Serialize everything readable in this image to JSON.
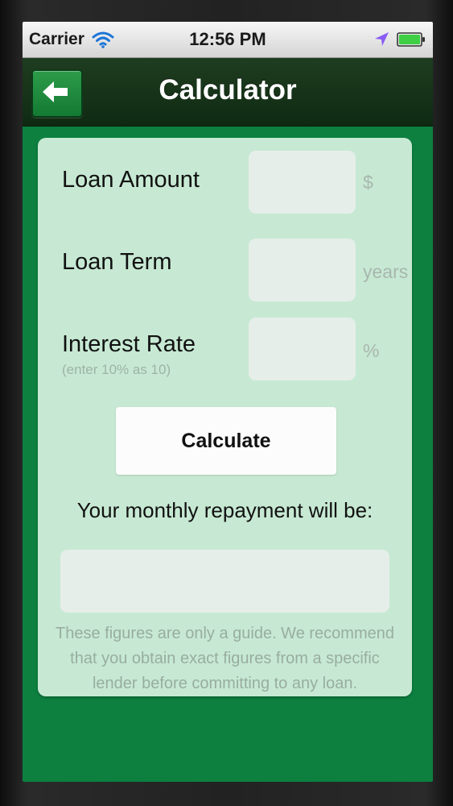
{
  "status_bar": {
    "carrier": "Carrier",
    "time": "12:56 PM"
  },
  "nav": {
    "title": "Calculator",
    "back_icon": "arrow-left-icon"
  },
  "form": {
    "loan_amount": {
      "label": "Loan Amount",
      "value": "",
      "unit": "$"
    },
    "loan_term": {
      "label": "Loan Term",
      "value": "",
      "unit": "years"
    },
    "interest_rate": {
      "label": "Interest Rate",
      "hint": "(enter 10% as 10)",
      "value": "",
      "unit": "%"
    }
  },
  "calculate_label": "Calculate",
  "result": {
    "label": "Your monthly repayment will be:",
    "value": ""
  },
  "disclaimer": "These figures are only a guide. We recommend that you obtain exact figures from a specific lender before committing to any loan.",
  "colors": {
    "screen_green": "#0d8040",
    "nav_dark_green": "#12301a",
    "card_mint": "#c7e9d3",
    "location_purple": "#8a5cf6",
    "battery_green": "#3fcf45"
  }
}
